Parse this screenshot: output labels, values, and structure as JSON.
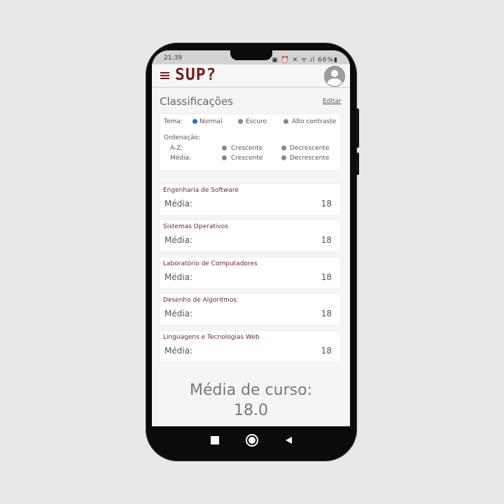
{
  "status": {
    "time": "21:39",
    "icons_text": "▣ ⏰ ✕ ᯤ.ıl 66%▮"
  },
  "app": {
    "logo": "SUP?"
  },
  "page": {
    "title": "Classificações",
    "edit_label": "Editar"
  },
  "theme": {
    "label": "Tema:",
    "options": [
      "Normal",
      "Escuro",
      "Alto contraste"
    ],
    "selected": "Normal"
  },
  "ordering": {
    "label": "Ordenação:",
    "rows": [
      {
        "label": "A-Z:",
        "options": [
          "Crescente",
          "Decrescente"
        ]
      },
      {
        "label": "Média:",
        "options": [
          "Crescente",
          "Decrescente"
        ]
      }
    ]
  },
  "courses": [
    {
      "name": "Engenharia de Software",
      "avg_label": "Média:",
      "value": "18"
    },
    {
      "name": "Sistemas Operativos",
      "avg_label": "Média:",
      "value": "18"
    },
    {
      "name": "Laboratório de Computadores",
      "avg_label": "Média:",
      "value": "18"
    },
    {
      "name": "Desenho de Algoritmos",
      "avg_label": "Média:",
      "value": "18"
    },
    {
      "name": "Linguagens e Tecnologias Web",
      "avg_label": "Média:",
      "value": "18"
    }
  ],
  "course_average": {
    "label": "Média de curso:",
    "value": "18.0"
  },
  "colors": {
    "brand": "#7b1a1f",
    "selected_radio": "#1976d2"
  }
}
